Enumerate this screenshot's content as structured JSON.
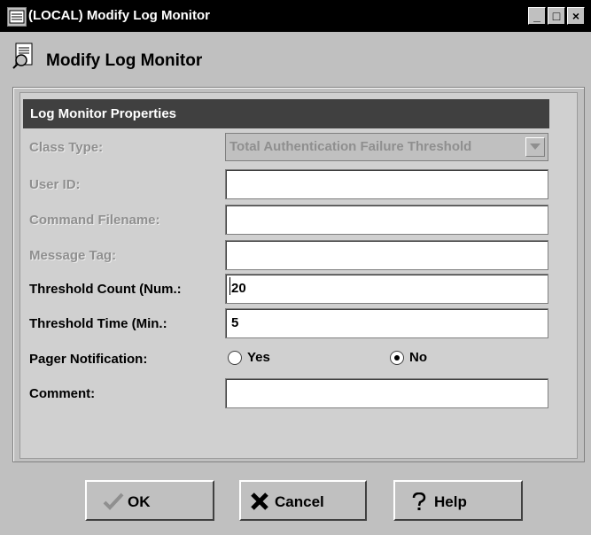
{
  "window": {
    "title": "(LOCAL) Modify Log Monitor",
    "controls": {
      "minimize": "_",
      "maximize": "□",
      "close": "×"
    }
  },
  "header": {
    "title": "Modify Log Monitor",
    "icon": "document-search-icon"
  },
  "section": {
    "title": "Log Monitor Properties"
  },
  "form": {
    "class_type": {
      "label": "Class Type:",
      "value": "Total Authentication Failure Threshold",
      "enabled": false
    },
    "user_id": {
      "label": "User ID:",
      "value": "",
      "enabled": false
    },
    "command_filename": {
      "label": "Command Filename:",
      "value": "",
      "enabled": false
    },
    "message_tag": {
      "label": "Message Tag:",
      "value": "",
      "enabled": false
    },
    "threshold_count": {
      "label": "Threshold Count (Num.:",
      "value": "20",
      "enabled": true
    },
    "threshold_time": {
      "label": "Threshold Time (Min.:",
      "value": "5",
      "enabled": true
    },
    "pager_notification": {
      "label": "Pager Notification:",
      "options": [
        "Yes",
        "No"
      ],
      "selected": "No"
    },
    "comment": {
      "label": "Comment:",
      "value": "",
      "enabled": true
    }
  },
  "buttons": {
    "ok": "OK",
    "cancel": "Cancel",
    "help": "Help"
  },
  "colors": {
    "background": "#c0c0c0",
    "titlebar": "#000000",
    "section_header": "#404040",
    "disabled_text": "#8f8f8f"
  }
}
